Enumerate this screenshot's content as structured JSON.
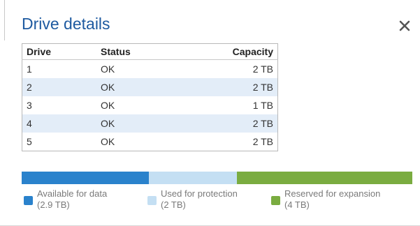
{
  "dialog": {
    "title": "Drive details",
    "close_label": "×"
  },
  "table": {
    "headers": {
      "drive": "Drive",
      "status": "Status",
      "capacity": "Capacity"
    },
    "rows": [
      {
        "drive": "1",
        "status": "OK",
        "capacity": "2 TB"
      },
      {
        "drive": "2",
        "status": "OK",
        "capacity": "2 TB"
      },
      {
        "drive": "3",
        "status": "OK",
        "capacity": "1 TB"
      },
      {
        "drive": "4",
        "status": "OK",
        "capacity": "2 TB"
      },
      {
        "drive": "5",
        "status": "OK",
        "capacity": "2 TB"
      }
    ]
  },
  "capacity": {
    "segments": [
      {
        "label": "Available for data",
        "amount": "(2.9 TB)",
        "value_tb": 2.9,
        "color": "#2a82cc"
      },
      {
        "label": "Used for protection",
        "amount": "(2 TB)",
        "value_tb": 2,
        "color": "#c4dff3"
      },
      {
        "label": "Reserved for expansion",
        "amount": "(4 TB)",
        "value_tb": 4,
        "color": "#7aac40"
      }
    ]
  },
  "colors": {
    "title": "#1e5aa0",
    "row_stripe": "#e3edf8",
    "close_icon": "#555555"
  }
}
